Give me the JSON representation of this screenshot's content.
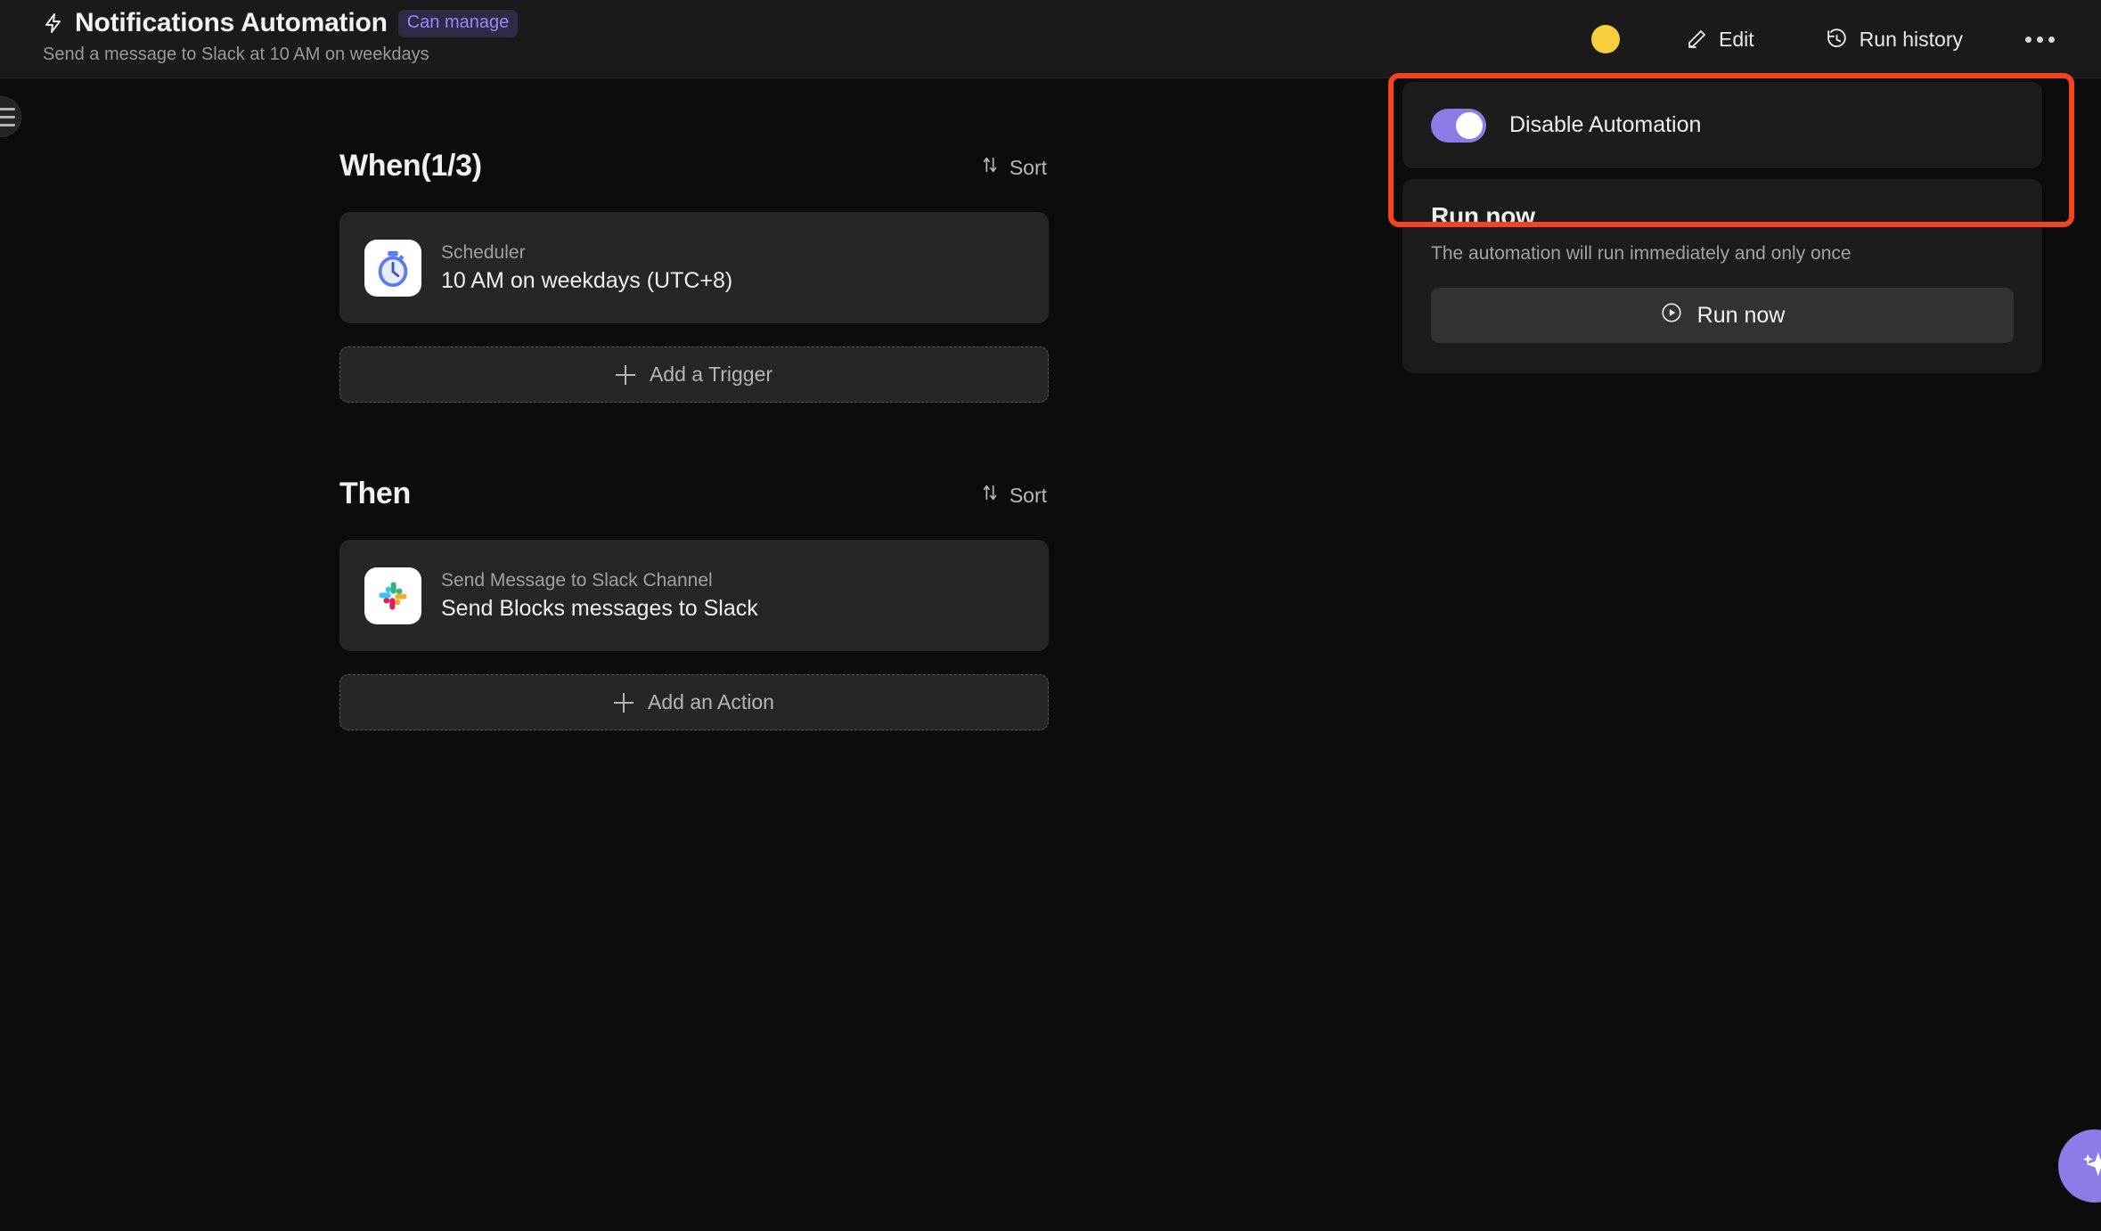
{
  "header": {
    "zap_icon": "zap-icon",
    "title": "Notifications Automation",
    "badge": "Can manage",
    "subtitle": "Send a message to Slack at 10 AM on weekdays",
    "avatar_color": "#f5cf3d",
    "edit_label": "Edit",
    "edit_icon": "pencil-icon",
    "run_history_label": "Run history",
    "run_history_icon": "history-icon",
    "more_icon": "more-horizontal-icon"
  },
  "sidebar_toggle": {
    "icon": "hamburger-icon"
  },
  "main": {
    "sections": [
      {
        "title": "When(1/3)",
        "sort_label": "Sort",
        "sort_icon": "sort-arrows-icon",
        "node": {
          "icon": "stopwatch-icon",
          "subtitle": "Scheduler",
          "title": "10 AM on weekdays (UTC+8)"
        },
        "add_label": "Add a Trigger",
        "add_icon": "plus-icon"
      },
      {
        "title": "Then",
        "sort_label": "Sort",
        "sort_icon": "sort-arrows-icon",
        "node": {
          "icon": "slack-icon",
          "subtitle": "Send Message to Slack Channel",
          "title": "Send Blocks messages to Slack"
        },
        "add_label": "Add an Action",
        "add_icon": "plus-icon"
      }
    ]
  },
  "right_panel": {
    "toggle": {
      "label": "Disable Automation",
      "state": "on",
      "accent": "#8b7ce8"
    },
    "run_now": {
      "title": "Run now",
      "description": "The automation will run immediately and only once",
      "button_label": "Run now",
      "button_icon": "play-circle-icon"
    }
  },
  "annotation": {
    "highlight_color": "#f4431f",
    "target": "disable-automation-toggle-card"
  },
  "fab": {
    "icon": "sparkle-ai-icon",
    "color": "#8b7ce8"
  }
}
